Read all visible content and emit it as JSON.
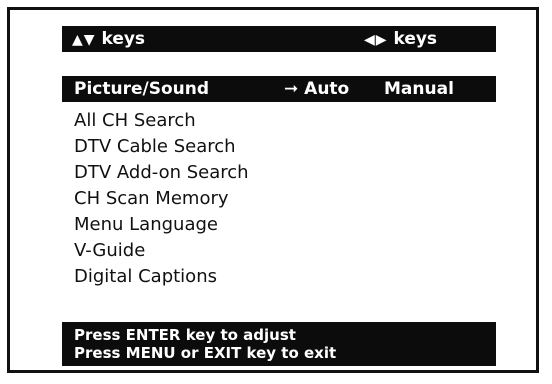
{
  "keys_bar": {
    "updown_symbol": "▲▼",
    "updown_label": "keys",
    "leftright_symbol": "◀▶",
    "leftright_label": "keys"
  },
  "mode_bar": {
    "title": "Picture/Sound",
    "arrow": "➞",
    "auto_label": "Auto",
    "manual_label": "Manual",
    "selected": "Auto"
  },
  "menu": {
    "items": [
      "All CH Search",
      "DTV Cable Search",
      "DTV Add-on Search",
      "CH Scan Memory",
      "Menu Language",
      "V-Guide",
      "Digital Captions"
    ]
  },
  "help": {
    "line1": "Press ENTER key to adjust",
    "line2": "Press MENU or EXIT key to exit"
  },
  "colors": {
    "bar_background": "#0c0c0c",
    "bar_text": "#ffffff",
    "text": "#111111",
    "frame": "#111111"
  }
}
